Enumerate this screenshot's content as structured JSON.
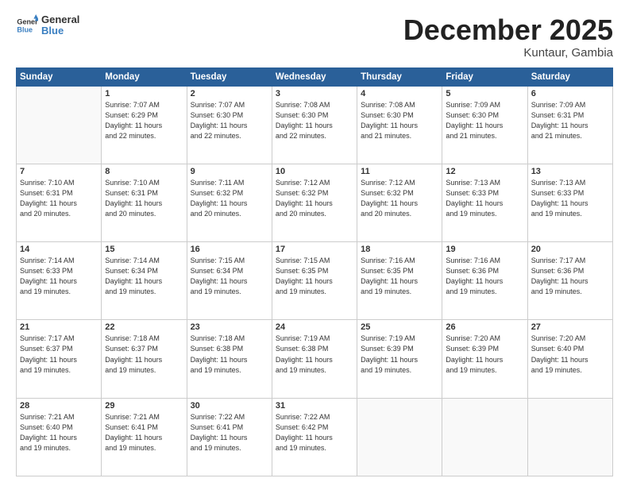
{
  "header": {
    "logo_general": "General",
    "logo_blue": "Blue",
    "month_title": "December 2025",
    "subtitle": "Kuntaur, Gambia"
  },
  "weekdays": [
    "Sunday",
    "Monday",
    "Tuesday",
    "Wednesday",
    "Thursday",
    "Friday",
    "Saturday"
  ],
  "weeks": [
    [
      {
        "day": "",
        "info": ""
      },
      {
        "day": "1",
        "info": "Sunrise: 7:07 AM\nSunset: 6:29 PM\nDaylight: 11 hours\nand 22 minutes."
      },
      {
        "day": "2",
        "info": "Sunrise: 7:07 AM\nSunset: 6:30 PM\nDaylight: 11 hours\nand 22 minutes."
      },
      {
        "day": "3",
        "info": "Sunrise: 7:08 AM\nSunset: 6:30 PM\nDaylight: 11 hours\nand 22 minutes."
      },
      {
        "day": "4",
        "info": "Sunrise: 7:08 AM\nSunset: 6:30 PM\nDaylight: 11 hours\nand 21 minutes."
      },
      {
        "day": "5",
        "info": "Sunrise: 7:09 AM\nSunset: 6:30 PM\nDaylight: 11 hours\nand 21 minutes."
      },
      {
        "day": "6",
        "info": "Sunrise: 7:09 AM\nSunset: 6:31 PM\nDaylight: 11 hours\nand 21 minutes."
      }
    ],
    [
      {
        "day": "7",
        "info": "Sunrise: 7:10 AM\nSunset: 6:31 PM\nDaylight: 11 hours\nand 20 minutes."
      },
      {
        "day": "8",
        "info": "Sunrise: 7:10 AM\nSunset: 6:31 PM\nDaylight: 11 hours\nand 20 minutes."
      },
      {
        "day": "9",
        "info": "Sunrise: 7:11 AM\nSunset: 6:32 PM\nDaylight: 11 hours\nand 20 minutes."
      },
      {
        "day": "10",
        "info": "Sunrise: 7:12 AM\nSunset: 6:32 PM\nDaylight: 11 hours\nand 20 minutes."
      },
      {
        "day": "11",
        "info": "Sunrise: 7:12 AM\nSunset: 6:32 PM\nDaylight: 11 hours\nand 20 minutes."
      },
      {
        "day": "12",
        "info": "Sunrise: 7:13 AM\nSunset: 6:33 PM\nDaylight: 11 hours\nand 19 minutes."
      },
      {
        "day": "13",
        "info": "Sunrise: 7:13 AM\nSunset: 6:33 PM\nDaylight: 11 hours\nand 19 minutes."
      }
    ],
    [
      {
        "day": "14",
        "info": "Sunrise: 7:14 AM\nSunset: 6:33 PM\nDaylight: 11 hours\nand 19 minutes."
      },
      {
        "day": "15",
        "info": "Sunrise: 7:14 AM\nSunset: 6:34 PM\nDaylight: 11 hours\nand 19 minutes."
      },
      {
        "day": "16",
        "info": "Sunrise: 7:15 AM\nSunset: 6:34 PM\nDaylight: 11 hours\nand 19 minutes."
      },
      {
        "day": "17",
        "info": "Sunrise: 7:15 AM\nSunset: 6:35 PM\nDaylight: 11 hours\nand 19 minutes."
      },
      {
        "day": "18",
        "info": "Sunrise: 7:16 AM\nSunset: 6:35 PM\nDaylight: 11 hours\nand 19 minutes."
      },
      {
        "day": "19",
        "info": "Sunrise: 7:16 AM\nSunset: 6:36 PM\nDaylight: 11 hours\nand 19 minutes."
      },
      {
        "day": "20",
        "info": "Sunrise: 7:17 AM\nSunset: 6:36 PM\nDaylight: 11 hours\nand 19 minutes."
      }
    ],
    [
      {
        "day": "21",
        "info": "Sunrise: 7:17 AM\nSunset: 6:37 PM\nDaylight: 11 hours\nand 19 minutes."
      },
      {
        "day": "22",
        "info": "Sunrise: 7:18 AM\nSunset: 6:37 PM\nDaylight: 11 hours\nand 19 minutes."
      },
      {
        "day": "23",
        "info": "Sunrise: 7:18 AM\nSunset: 6:38 PM\nDaylight: 11 hours\nand 19 minutes."
      },
      {
        "day": "24",
        "info": "Sunrise: 7:19 AM\nSunset: 6:38 PM\nDaylight: 11 hours\nand 19 minutes."
      },
      {
        "day": "25",
        "info": "Sunrise: 7:19 AM\nSunset: 6:39 PM\nDaylight: 11 hours\nand 19 minutes."
      },
      {
        "day": "26",
        "info": "Sunrise: 7:20 AM\nSunset: 6:39 PM\nDaylight: 11 hours\nand 19 minutes."
      },
      {
        "day": "27",
        "info": "Sunrise: 7:20 AM\nSunset: 6:40 PM\nDaylight: 11 hours\nand 19 minutes."
      }
    ],
    [
      {
        "day": "28",
        "info": "Sunrise: 7:21 AM\nSunset: 6:40 PM\nDaylight: 11 hours\nand 19 minutes."
      },
      {
        "day": "29",
        "info": "Sunrise: 7:21 AM\nSunset: 6:41 PM\nDaylight: 11 hours\nand 19 minutes."
      },
      {
        "day": "30",
        "info": "Sunrise: 7:22 AM\nSunset: 6:41 PM\nDaylight: 11 hours\nand 19 minutes."
      },
      {
        "day": "31",
        "info": "Sunrise: 7:22 AM\nSunset: 6:42 PM\nDaylight: 11 hours\nand 19 minutes."
      },
      {
        "day": "",
        "info": ""
      },
      {
        "day": "",
        "info": ""
      },
      {
        "day": "",
        "info": ""
      }
    ]
  ]
}
